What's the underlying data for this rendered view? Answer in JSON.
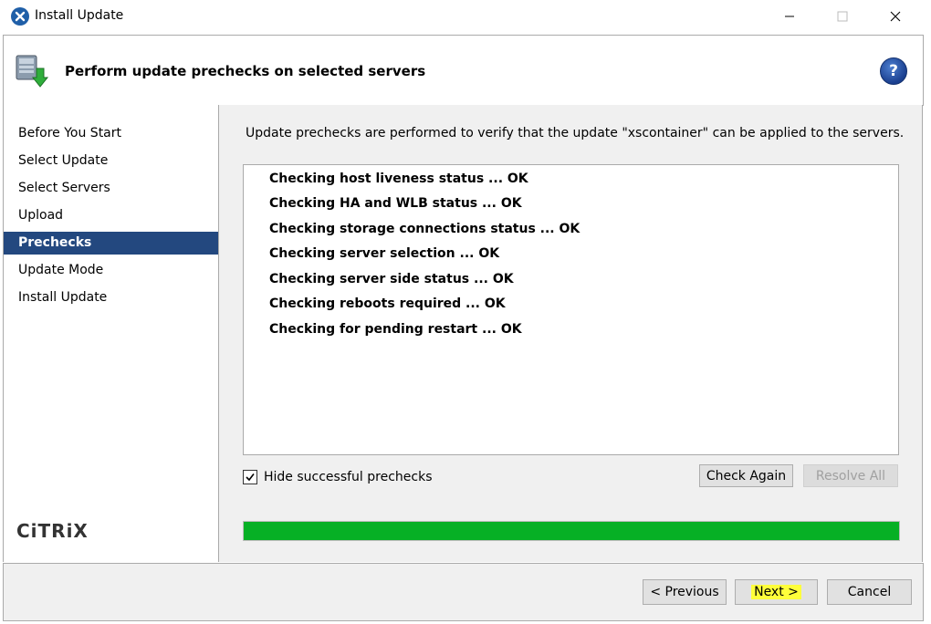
{
  "window": {
    "title": "Install Update"
  },
  "header": {
    "title": "Perform update prechecks on selected servers"
  },
  "sidebar": {
    "items": [
      {
        "label": "Before You Start",
        "active": false
      },
      {
        "label": "Select Update",
        "active": false
      },
      {
        "label": "Select Servers",
        "active": false
      },
      {
        "label": "Upload",
        "active": false
      },
      {
        "label": "Prechecks",
        "active": true
      },
      {
        "label": "Update Mode",
        "active": false
      },
      {
        "label": "Install Update",
        "active": false
      }
    ],
    "logo": "CiTRiX"
  },
  "main": {
    "intro": "Update prechecks are performed to verify that the update \"xscontainer\" can be applied to the servers.",
    "checks": [
      "Checking host liveness status ... OK",
      "Checking HA and WLB status ... OK",
      "Checking storage connections status ... OK",
      "Checking server selection ... OK",
      "Checking server side status ... OK",
      "Checking reboots required ... OK",
      "Checking for pending restart ... OK"
    ],
    "hide_successful_label": "Hide successful prechecks",
    "hide_successful_checked": true,
    "check_again_label": "Check Again",
    "resolve_all_label": "Resolve All",
    "progress": 1.0
  },
  "footer": {
    "previous_label": "< Previous",
    "next_label": "Next >",
    "cancel_label": "Cancel"
  },
  "colors": {
    "active_nav": "#23487f",
    "progress": "#06b025",
    "next_highlight": "#ffff3a"
  }
}
